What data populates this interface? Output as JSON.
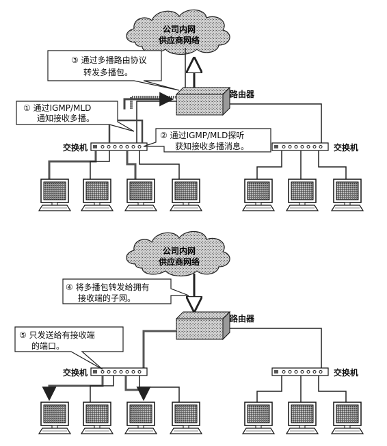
{
  "top": {
    "cloud_line1": "公司内网",
    "cloud_line2": "供应商网络",
    "router_label": "路由器",
    "switch_left_label": "交换机",
    "switch_right_label": "交换机",
    "callout_3_line1": "③ 通过多播路由协议",
    "callout_3_line2": "转发多播包。",
    "callout_1_line1": "① 通过IGMP/MLD",
    "callout_1_line2": "通知接收多播。",
    "callout_2_line1": "② 通过IGMP/MLD探听",
    "callout_2_line2": "获知接收多播消息。"
  },
  "bottom": {
    "cloud_line1": "公司内网",
    "cloud_line2": "供应商网络",
    "router_label": "路由器",
    "switch_left_label": "交换机",
    "switch_right_label": "交换机",
    "callout_4_line1": "④ 将多播包转发给拥有",
    "callout_4_line2": "接收端的子网。",
    "callout_5_line1": "⑤ 只发送给有接收端",
    "callout_5_line2": "的端口。"
  }
}
